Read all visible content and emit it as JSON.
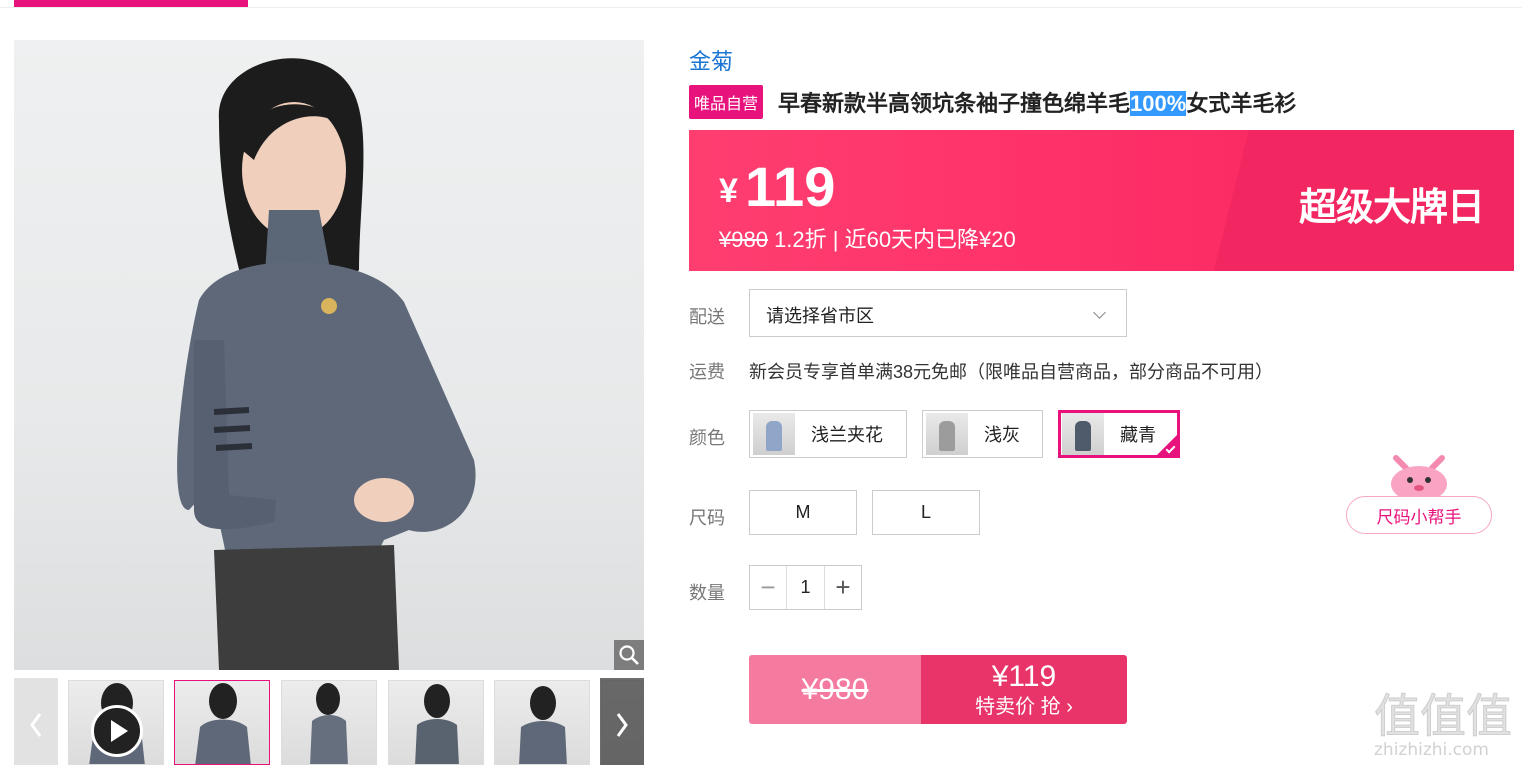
{
  "brand": "金菊",
  "self_operated_tag": "唯品自营",
  "title_before": "早春新款半高领坑条袖子撞色绵羊毛",
  "title_highlight": "100%",
  "title_after": "女式羊毛衫",
  "price": {
    "currency": "¥",
    "current": "119",
    "original": "¥980",
    "discount_note": " 1.2折 | 近60天内已降¥20",
    "promo": "超级大牌日"
  },
  "delivery": {
    "label": "配送",
    "placeholder": "请选择省市区"
  },
  "shipping": {
    "label": "运费",
    "text": "新会员专享首单满38元免邮（限唯品自营商品，部分商品不可用）"
  },
  "colors": {
    "label": "颜色",
    "options": [
      "浅兰夹花",
      "浅灰",
      "藏青"
    ],
    "selected": "藏青"
  },
  "sizes": {
    "label": "尺码",
    "options": [
      "M",
      "L"
    ]
  },
  "quantity": {
    "label": "数量",
    "value": "1",
    "minus": "−",
    "plus": "+"
  },
  "buy": {
    "original": "¥980",
    "price": "¥119",
    "action": "特卖价 抢 ›"
  },
  "size_helper": "尺码小帮手",
  "watermark": {
    "logo": "值值值",
    "domain": "zhizhizhi.com"
  },
  "colors_theme": {
    "accent": "#e8127d",
    "price_band": "#fd2d66",
    "brand_link": "#1a76d2"
  }
}
